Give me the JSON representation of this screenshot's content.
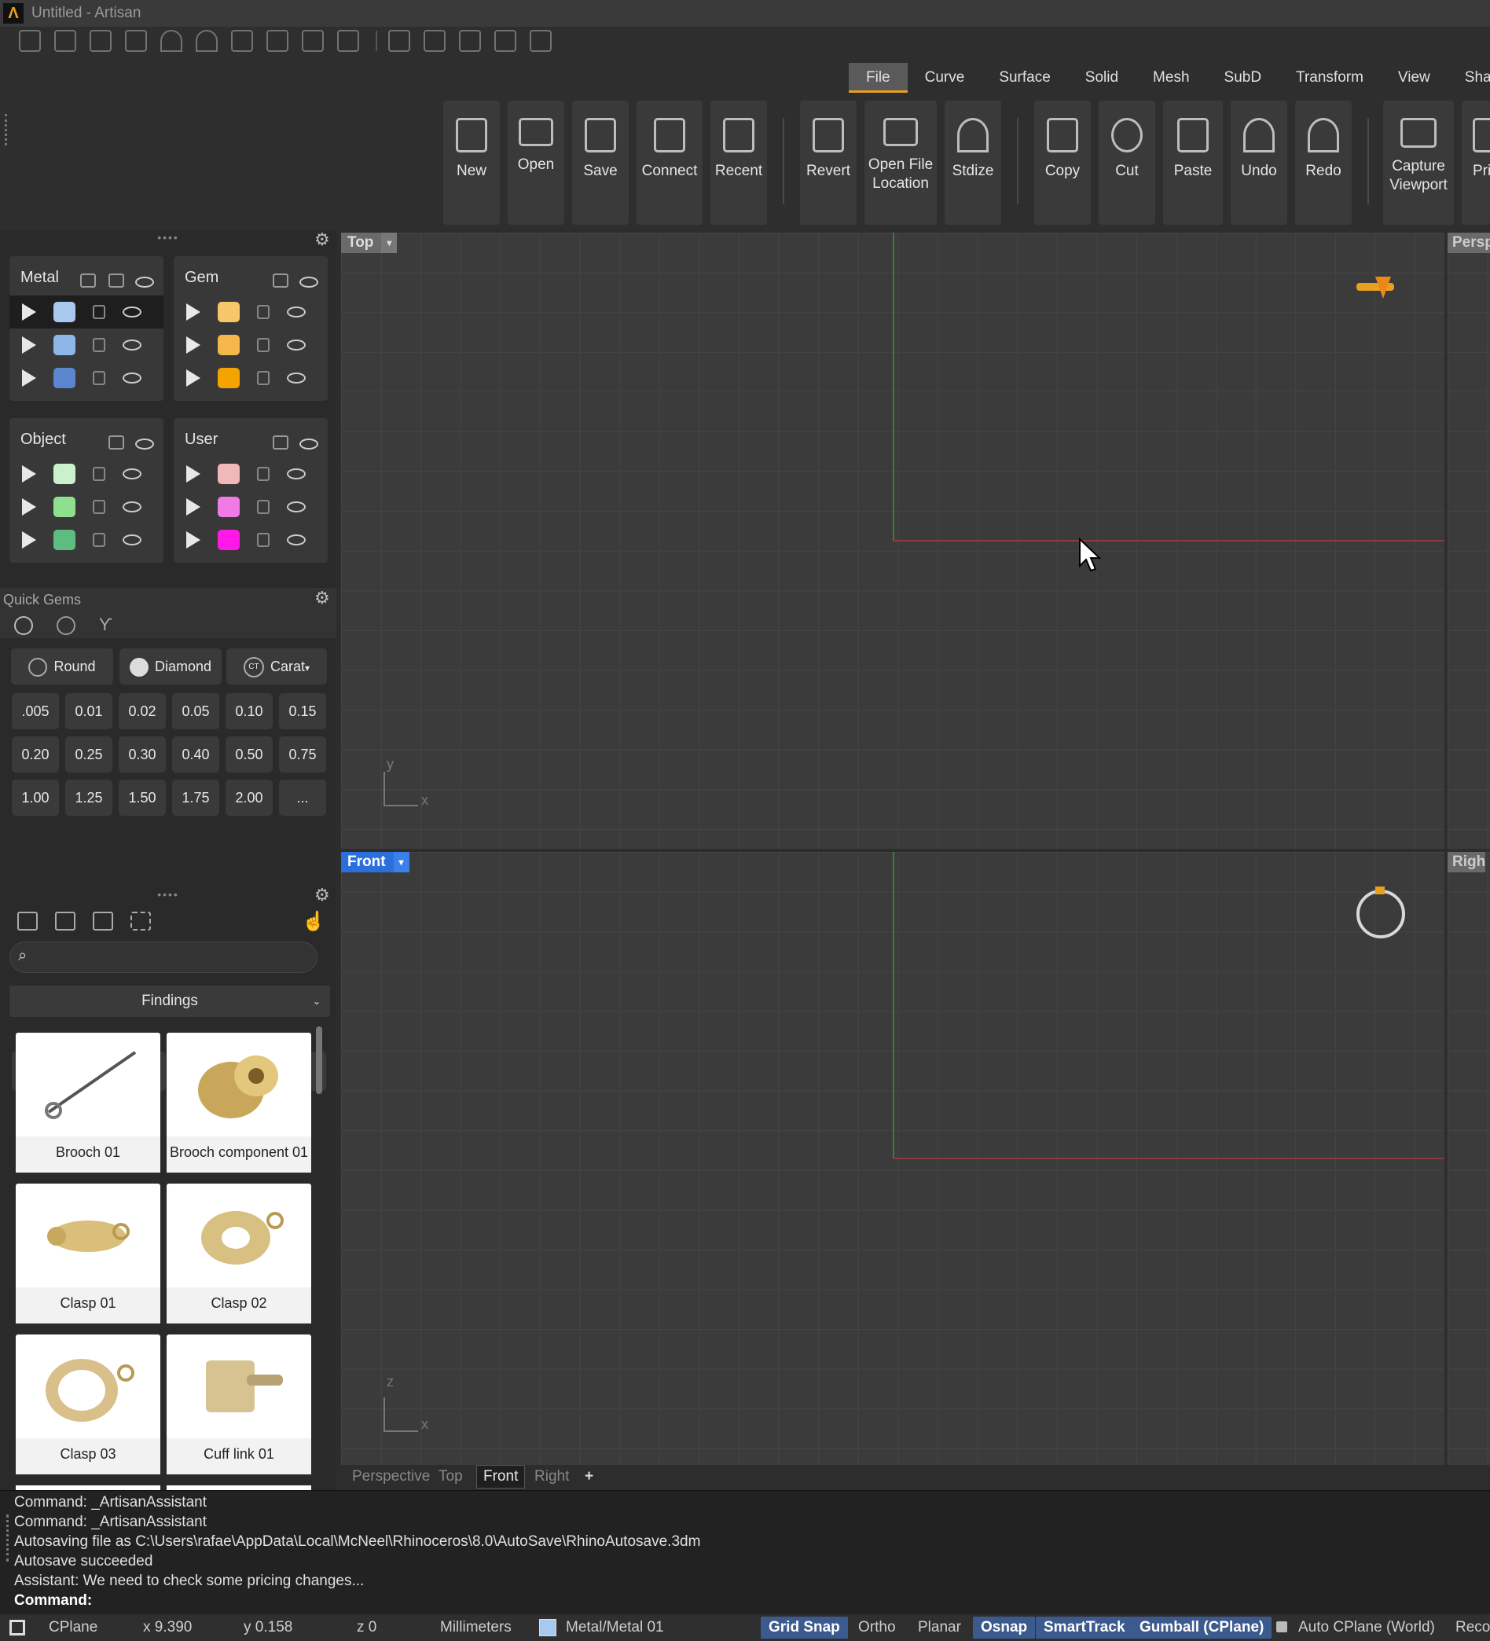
{
  "window": {
    "title": "Untitled - Artisan",
    "logo": "Λ"
  },
  "ribbon": {
    "tabs": [
      "File",
      "Curve",
      "Surface",
      "Solid",
      "Mesh",
      "SubD",
      "Transform",
      "View",
      "Shanks"
    ],
    "active_tab": "File",
    "buttons": [
      {
        "label": "New",
        "icon": "new-file-icon"
      },
      {
        "label": "Open",
        "icon": "folder-open-icon"
      },
      {
        "label": "Save",
        "icon": "floppy-icon"
      },
      {
        "label": "Connect",
        "icon": "save-globe-icon"
      },
      {
        "label": "Recent",
        "icon": "recent-file-icon"
      },
      {
        "label": "Revert",
        "icon": "revert-icon"
      },
      {
        "label": "Open File Location",
        "line1": "Open File",
        "line2": "Location",
        "icon": "folder-location-icon"
      },
      {
        "label": "Stdize",
        "icon": "standardize-icon"
      },
      {
        "label": "Copy",
        "icon": "copy-icon"
      },
      {
        "label": "Cut",
        "icon": "scissors-icon"
      },
      {
        "label": "Paste",
        "icon": "paste-icon"
      },
      {
        "label": "Undo",
        "icon": "undo-icon"
      },
      {
        "label": "Redo",
        "icon": "redo-icon"
      },
      {
        "label": "Capture Viewport",
        "line1": "Capture",
        "line2": "Viewport",
        "icon": "monitor-icon"
      },
      {
        "label": "Pri",
        "icon": "printer-icon"
      }
    ]
  },
  "layers": {
    "metal": {
      "title": "Metal",
      "colors": [
        "#a9c8f0",
        "#8fb6e8",
        "#5b86cf"
      ]
    },
    "gem": {
      "title": "Gem",
      "colors": [
        "#f7c66a",
        "#f5b64a",
        "#f5a300"
      ]
    },
    "object": {
      "title": "Object",
      "colors": [
        "#c9f2cc",
        "#8ee08e",
        "#5cbd7e"
      ]
    },
    "user": {
      "title": "User",
      "colors": [
        "#f0b8b8",
        "#f07ae6",
        "#ff18e8"
      ]
    }
  },
  "quick_gems": {
    "title": "Quick Gems",
    "cut": "Round",
    "material": "Diamond",
    "unit": "Carat",
    "unit_badge": "CT",
    "sizes": [
      ".005",
      "0.01",
      "0.02",
      "0.05",
      "0.10",
      "0.15",
      "0.20",
      "0.25",
      "0.30",
      "0.40",
      "0.50",
      "0.75",
      "1.00",
      "1.25",
      "1.50",
      "1.75",
      "2.00",
      "..."
    ]
  },
  "library": {
    "search_placeholder": "",
    "category": "Findings",
    "items": [
      "Brooch 01",
      "Brooch component 01",
      "Clasp 01",
      "Clasp 02",
      "Clasp 03",
      "Cuff link 01"
    ]
  },
  "viewports": {
    "top": {
      "label": "Top",
      "axis_v": "y",
      "axis_h": "x"
    },
    "front": {
      "label": "Front",
      "axis_v": "z",
      "axis_h": "x"
    },
    "persp": {
      "label": "Persp"
    },
    "right": {
      "label": "Righ"
    },
    "tabs": [
      "Perspective",
      "Top",
      "Front",
      "Right"
    ],
    "active_tab": "Front",
    "add": "+"
  },
  "command": {
    "history": [
      "Command: _ArtisanAssistant",
      "Command: _ArtisanAssistant",
      "Autosaving file as C:\\Users\\rafae\\AppData\\Local\\McNeel\\Rhinoceros\\8.0\\AutoSave\\RhinoAutosave.3dm",
      "Autosave succeeded",
      "Assistant: We need to check some pricing changes..."
    ],
    "prompt": "Command:"
  },
  "status": {
    "cplane": "CPlane",
    "x": "x 9.390",
    "y": "y 0.158",
    "z": "z 0",
    "units": "Millimeters",
    "layer": "Metal/Metal 01",
    "layer_color": "#a9c8f0",
    "grid_snap": "Grid Snap",
    "ortho": "Ortho",
    "planar": "Planar",
    "osnap": "Osnap",
    "smarttrack": "SmartTrack",
    "gumball": "Gumball (CPlane)",
    "auto_cplane": "Auto CPlane (World)",
    "record": "Reco"
  }
}
